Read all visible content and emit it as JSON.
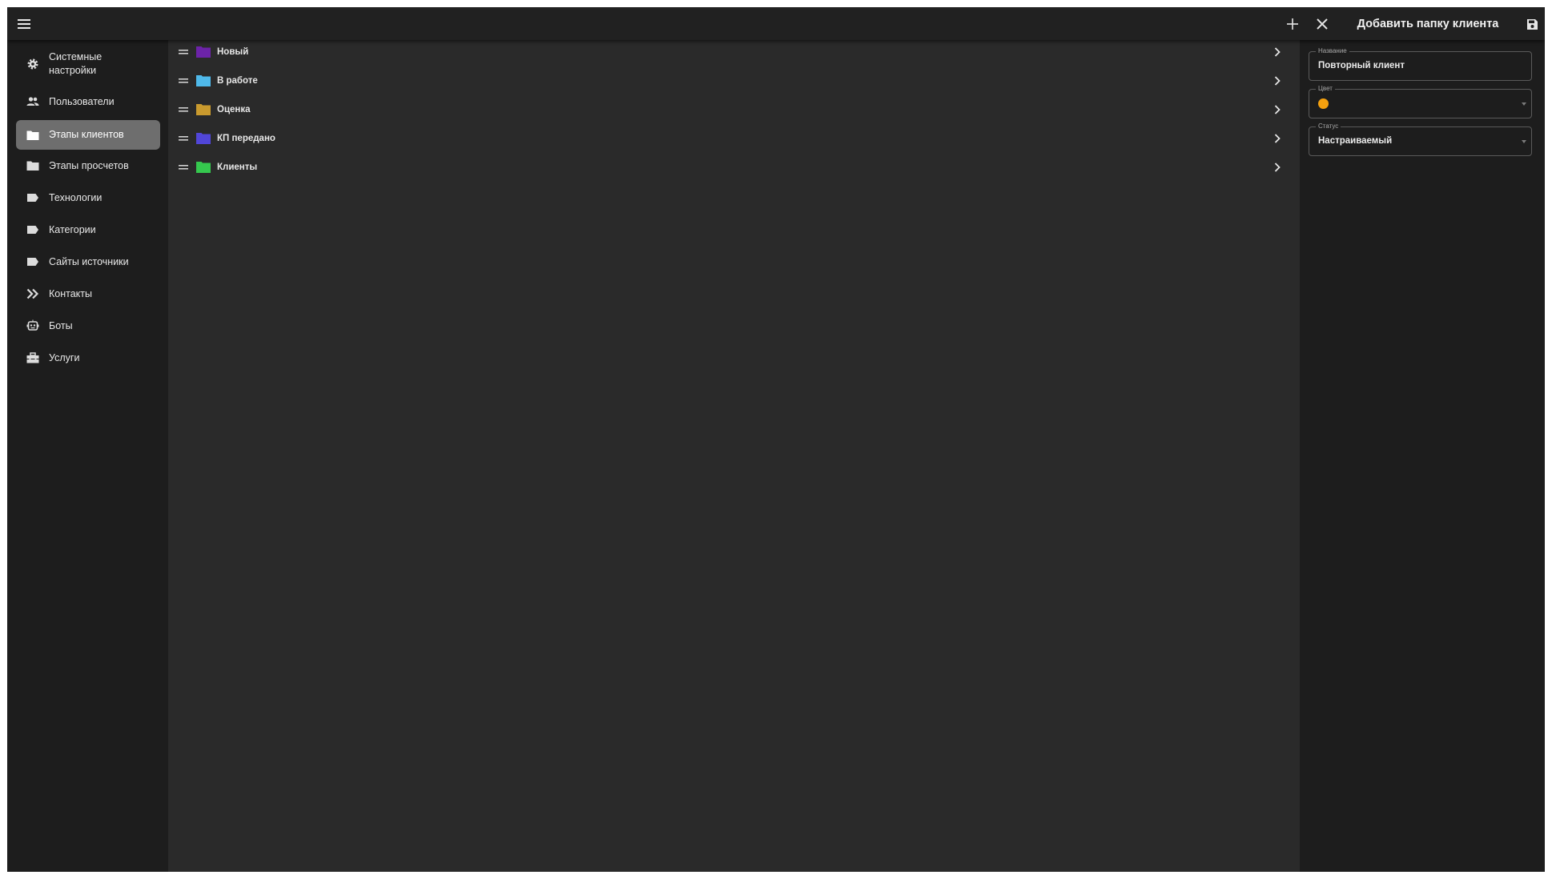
{
  "header": {
    "panel_title": "Добавить папку клиента",
    "icons": [
      "menu-icon",
      "plus-icon",
      "close-icon",
      "save-icon"
    ]
  },
  "sidebar": {
    "items": [
      {
        "label": "Системные настройки",
        "icon": "gear-icon"
      },
      {
        "label": "Пользователи",
        "icon": "users-icon"
      },
      {
        "label": "Этапы клиентов",
        "icon": "folder-icon",
        "active": true
      },
      {
        "label": "Этапы просчетов",
        "icon": "folder-icon"
      },
      {
        "label": "Технологии",
        "icon": "label-icon"
      },
      {
        "label": "Категории",
        "icon": "label-icon"
      },
      {
        "label": "Сайты источники",
        "icon": "label-icon"
      },
      {
        "label": "Контакты",
        "icon": "double-chevron-icon"
      },
      {
        "label": "Боты",
        "icon": "robot-icon"
      },
      {
        "label": "Услуги",
        "icon": "toolbox-icon"
      }
    ]
  },
  "folders": [
    {
      "name": "Новый",
      "color": "#6c23a8"
    },
    {
      "name": "В работе",
      "color": "#4fb9ea"
    },
    {
      "name": "Оценка",
      "color": "#c99a2e"
    },
    {
      "name": "КП передано",
      "color": "#5146d8"
    },
    {
      "name": "Клиенты",
      "color": "#35c84e"
    }
  ],
  "form": {
    "name_label": "Название",
    "name_value": "Повторный клиент",
    "color_label": "Цвет",
    "color_value": "#f5a10f",
    "status_label": "Статус",
    "status_value": "Настраиваемый"
  }
}
